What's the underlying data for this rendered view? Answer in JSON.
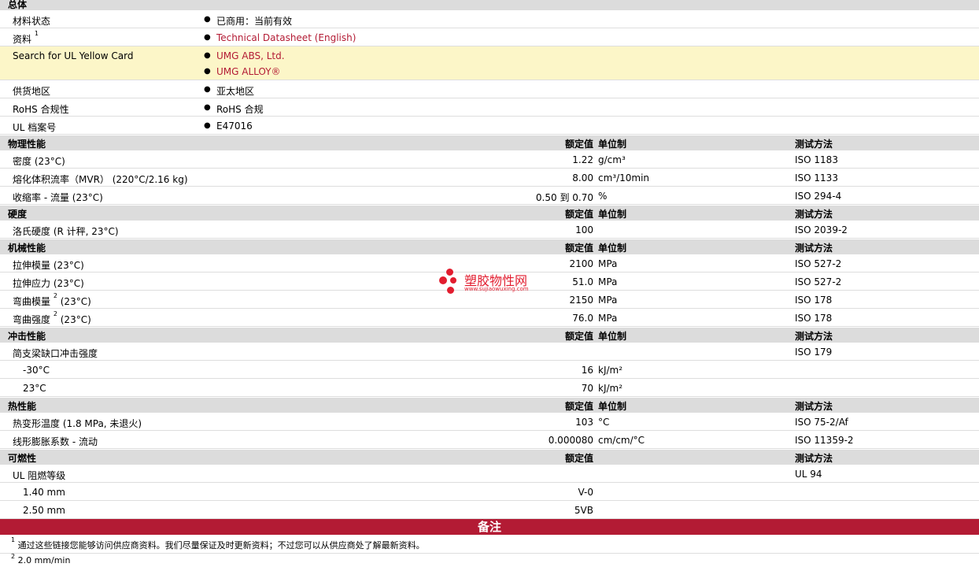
{
  "general": {
    "title": "总体",
    "rows": {
      "status": {
        "label": "材料状态",
        "value": "已商用：当前有效"
      },
      "docs": {
        "label": "资料",
        "sup": "1",
        "value": "Technical Datasheet (English)"
      },
      "ul_search": {
        "label": "Search for UL Yellow Card",
        "value1": "UMG ABS, Ltd.",
        "value2": "UMG ALLOY®"
      },
      "region": {
        "label": "供货地区",
        "value": "亚太地区"
      },
      "rohs": {
        "label": "RoHS 合规性",
        "value": "RoHS 合规"
      },
      "ul_file": {
        "label": "UL 档案号",
        "value": "E47016"
      }
    }
  },
  "col_headers": {
    "nominal": "额定值",
    "unit": "单位制",
    "method": "测试方法"
  },
  "physical": {
    "title": "物理性能",
    "rows": [
      {
        "label": "密度 (23°C)",
        "num": "1.22",
        "unit": "g/cm³",
        "method": "ISO 1183"
      },
      {
        "label": "熔化体积流率（MVR） (220°C/2.16 kg)",
        "num": "8.00",
        "unit": "cm³/10min",
        "method": "ISO 1133"
      },
      {
        "label": "收缩率  - 流量 (23°C)",
        "num": "0.50 到  0.70",
        "unit": "%",
        "method": "ISO 294-4"
      }
    ]
  },
  "hardness": {
    "title": "硬度",
    "rows": [
      {
        "label": "洛氏硬度 (R 计秤, 23°C)",
        "num": "100",
        "unit": "",
        "method": "ISO 2039-2"
      }
    ]
  },
  "mechanical": {
    "title": "机械性能",
    "rows": [
      {
        "label": "拉伸模量 (23°C)",
        "num": "2100",
        "unit": "MPa",
        "method": "ISO 527-2"
      },
      {
        "label": "拉伸应力 (23°C)",
        "num": "51.0",
        "unit": "MPa",
        "method": "ISO 527-2"
      },
      {
        "label": "弯曲模量",
        "sup": "2",
        "tail": " (23°C)",
        "num": "2150",
        "unit": "MPa",
        "method": "ISO 178"
      },
      {
        "label": "弯曲强度",
        "sup": "2",
        "tail": " (23°C)",
        "num": "76.0",
        "unit": "MPa",
        "method": "ISO 178"
      }
    ]
  },
  "impact": {
    "title": "冲击性能",
    "rows": [
      {
        "label": "简支梁缺口冲击强度",
        "num": "",
        "unit": "",
        "method": "ISO 179"
      },
      {
        "label": "-30°C",
        "num": "16",
        "unit": "kJ/m²",
        "method": ""
      },
      {
        "label": "23°C",
        "num": "70",
        "unit": "kJ/m²",
        "method": ""
      }
    ]
  },
  "thermal": {
    "title": "热性能",
    "rows": [
      {
        "label": "热变形温度 (1.8 MPa, 未退火)",
        "num": "103",
        "unit": "°C",
        "method": "ISO 75-2/Af"
      },
      {
        "label": "线形膨胀系数  - 流动",
        "num": "0.000080",
        "unit": "cm/cm/°C",
        "method": "ISO 11359-2"
      }
    ]
  },
  "flammability": {
    "title": "可燃性",
    "rows": [
      {
        "label": "UL 阻燃等级",
        "num": "",
        "unit": "",
        "method": "UL 94"
      },
      {
        "label": "1.40 mm",
        "num": "V-0",
        "unit": "",
        "method": ""
      },
      {
        "label": "2.50 mm",
        "num": "5VB",
        "unit": "",
        "method": ""
      }
    ]
  },
  "notes": {
    "title": "备注",
    "items": [
      {
        "sup": "1",
        "text": "通过这些链接您能够访问供应商资料。我们尽量保证及时更新资料；不过您可以从供应商处了解最新资料。"
      },
      {
        "sup": "2",
        "text": "2.0 mm/min"
      }
    ]
  },
  "watermark": {
    "text": "塑胶物性网",
    "url": "www.sujiaowuxing.com"
  },
  "colors": {
    "header_bg": "#dcdcdc",
    "highlight_bg": "#fcf6c8",
    "link": "#b31b34",
    "notes_bar": "#b31b34"
  }
}
